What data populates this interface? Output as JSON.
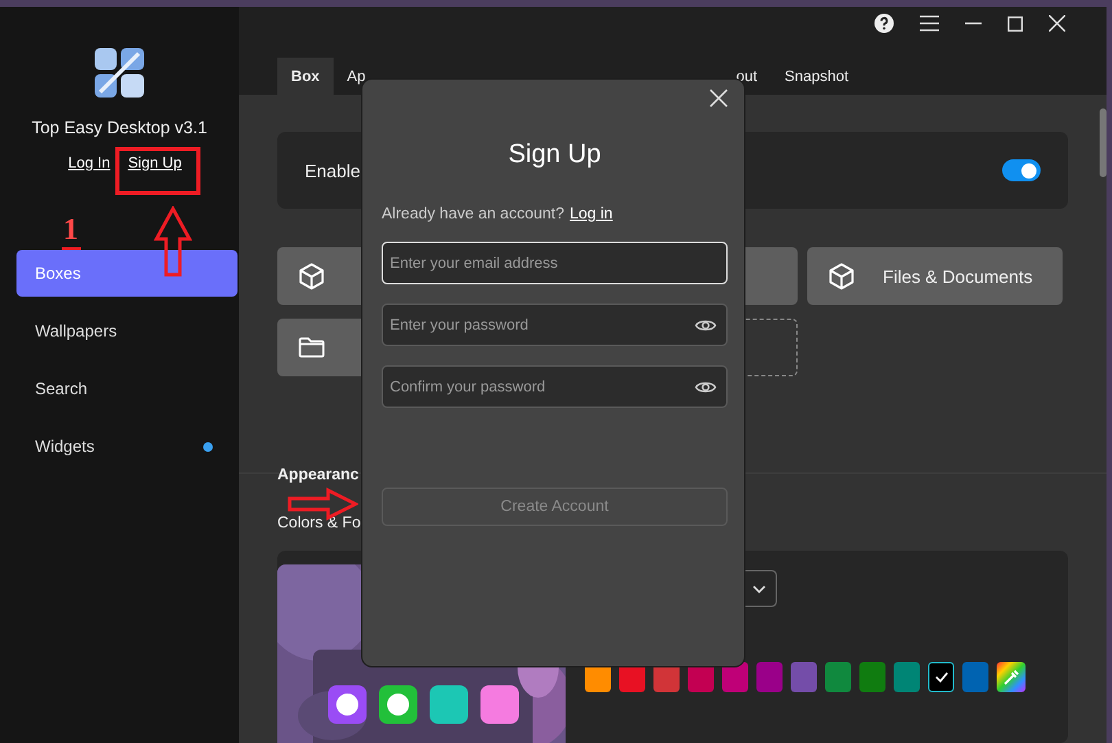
{
  "sidebar": {
    "app_name": "Top Easy Desktop v3.1",
    "auth_links": [
      {
        "label": "Log In"
      },
      {
        "label": "Sign Up"
      }
    ],
    "items": [
      {
        "label": "Boxes",
        "selected": true,
        "dot": false
      },
      {
        "label": "Wallpapers",
        "selected": false,
        "dot": false
      },
      {
        "label": "Search",
        "selected": false,
        "dot": false
      },
      {
        "label": "Widgets",
        "selected": false,
        "dot": true
      }
    ]
  },
  "tabs": [
    {
      "label": "Box",
      "selected": true
    },
    {
      "label": "Ap",
      "selected": false
    },
    {
      "label": "out",
      "selected": false
    },
    {
      "label": "Snapshot",
      "selected": false
    }
  ],
  "enable_card": {
    "label": "Enable",
    "on": true
  },
  "box_buttons": [
    {
      "kind": "cube"
    },
    {
      "kind": "blank"
    },
    {
      "kind": "cube",
      "label": "Files & Documents"
    },
    {
      "kind": "folder"
    },
    {
      "kind": "add"
    }
  ],
  "appearance": {
    "heading": "Appearanc",
    "subheading": "Colors & Fo",
    "swatches": [
      {
        "color": "#ff8c00",
        "selected": false,
        "kind": "color"
      },
      {
        "color": "#e81123",
        "selected": false,
        "kind": "color"
      },
      {
        "color": "#d13438",
        "selected": false,
        "kind": "color"
      },
      {
        "color": "#c30052",
        "selected": false,
        "kind": "color"
      },
      {
        "color": "#bf0077",
        "selected": false,
        "kind": "color"
      },
      {
        "color": "#9a0089",
        "selected": false,
        "kind": "color"
      },
      {
        "color": "#744da9",
        "selected": false,
        "kind": "color"
      },
      {
        "color": "#10893e",
        "selected": false,
        "kind": "color"
      },
      {
        "color": "#107c10",
        "selected": false,
        "kind": "color"
      },
      {
        "color": "#008575",
        "selected": false,
        "kind": "color"
      },
      {
        "color": "#000000",
        "selected": true,
        "kind": "color"
      },
      {
        "color": "#0063b1",
        "selected": false,
        "kind": "color"
      },
      {
        "kind": "picker",
        "selected": false
      }
    ]
  },
  "sign_up_dialog": {
    "title": "Sign Up",
    "prompt": "Already have an account?",
    "login_link": "Log in",
    "fields": [
      {
        "placeholder": "Enter your email address",
        "focused": true,
        "reveal": false
      },
      {
        "placeholder": "Enter your password",
        "focused": false,
        "reveal": true
      },
      {
        "placeholder": "Confirm your password",
        "focused": false,
        "reveal": true
      }
    ],
    "button": {
      "label": "Create Account",
      "disabled": true
    }
  },
  "annotation": {
    "number": "1"
  }
}
